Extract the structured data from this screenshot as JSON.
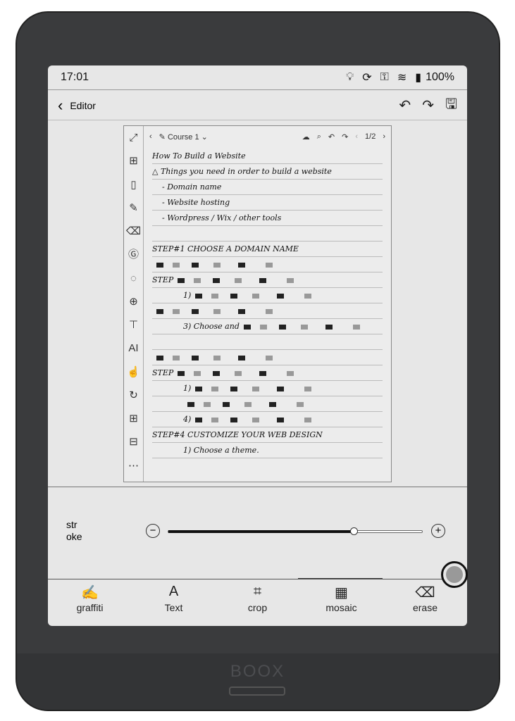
{
  "device": {
    "brand": "BOOX"
  },
  "status": {
    "time": "17:01",
    "battery": "100%",
    "icons": [
      "lightbulb-icon",
      "sync-icon",
      "key-icon",
      "wifi-icon",
      "battery-icon"
    ]
  },
  "header": {
    "back": "‹",
    "title": "Editor"
  },
  "note": {
    "notebook": "Course 1",
    "page": "1/2",
    "lines": [
      "How To Build a Website",
      "△ Things you need in order to build a website",
      "- Domain name",
      "- Website hosting",
      "- Wordpress / Wix / other tools",
      "",
      "STEP#1  CHOOSE A DOMAIN NAME",
      "",
      "STEP",
      "1)",
      "",
      "3) Choose and",
      "",
      "",
      "STEP",
      "1)",
      "",
      "4)",
      "STEP#4  CUSTOMIZE YOUR WEB DESIGN",
      "1) Choose a theme."
    ]
  },
  "panel": {
    "label": "str\noke",
    "slider_value": 0.73
  },
  "toolbar": {
    "items": [
      {
        "label": "graffiti",
        "icon": "pen-icon"
      },
      {
        "label": "Text",
        "icon": "text-icon"
      },
      {
        "label": "crop",
        "icon": "crop-icon"
      },
      {
        "label": "mosaic",
        "icon": "mosaic-icon"
      },
      {
        "label": "erase",
        "icon": "eraser-icon"
      }
    ],
    "selected": "mosaic"
  }
}
